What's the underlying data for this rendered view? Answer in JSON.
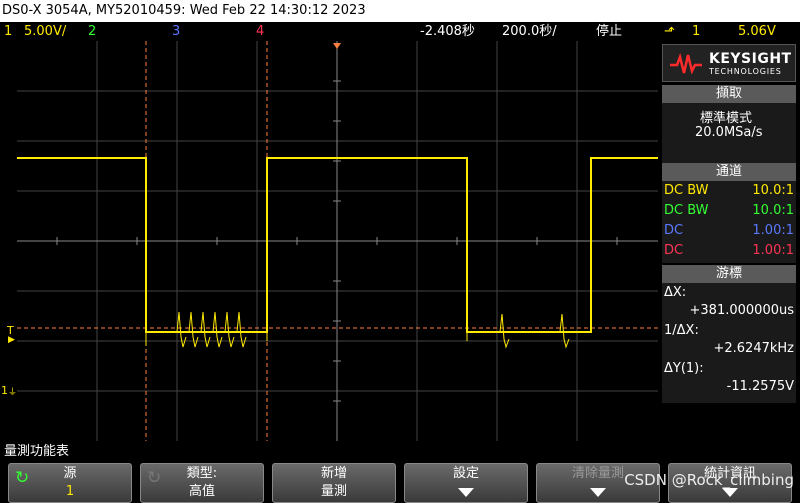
{
  "title_bar": {
    "text": "DS0-X 3054A, MY52010459: Wed Feb 22 14:30:12 2023"
  },
  "channel_bar": {
    "ch1_num": "1",
    "ch1_scale": "5.00V/",
    "ch2_num": "2",
    "ch3_num": "3",
    "ch4_num": "4",
    "time_offset": "-2.408秒",
    "time_scale": "200.0秒/",
    "run_state": "停止",
    "trig_slope": "⬏",
    "trig_ch": "1",
    "trig_level": "5.06V"
  },
  "colors": {
    "ch1": "#ffea00",
    "ch2": "#33ff33",
    "ch3": "#5a78ff",
    "ch4": "#ff3355",
    "cursor": "#ff8040"
  },
  "gutter": {
    "trig_marker": "T",
    "ch1_marker": "1"
  },
  "panel": {
    "brand": "KEYSIGHT",
    "brand_sub": "TECHNOLOGIES",
    "acq_header": "擷取",
    "acq_mode": "標準模式",
    "acq_rate": "20.0MSa/s",
    "ch_header": "通道",
    "channels": [
      {
        "coupling": "DC BW",
        "probe": "10.0:1"
      },
      {
        "coupling": "DC BW",
        "probe": "10.0:1"
      },
      {
        "coupling": "DC",
        "probe": "1.00:1"
      },
      {
        "coupling": "DC",
        "probe": "1.00:1"
      }
    ],
    "cursor_header": "游標",
    "dx_label": "ΔX:",
    "dx_value": "+381.000000us",
    "inv_dx_label": "1/ΔX:",
    "inv_dx_value": "+2.6247kHz",
    "dy_label": "ΔY(1):",
    "dy_value": "-11.2575V"
  },
  "bottom_label": "量測功能表",
  "softkeys": [
    {
      "l1": "源",
      "l2": "1"
    },
    {
      "l1": "類型:",
      "l2": "高值"
    },
    {
      "l1": "新增",
      "l2": "量測"
    },
    {
      "l1": "設定",
      "l2": ""
    },
    {
      "l1": "清除量測",
      "l2": ""
    },
    {
      "l1": "統計資訊",
      "l2": ""
    }
  ],
  "watermark": "CSDN @Rock_climbing"
}
